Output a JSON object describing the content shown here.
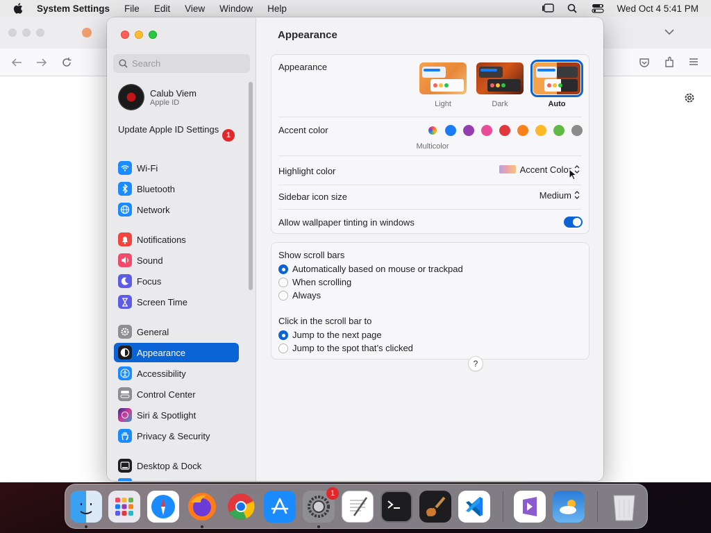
{
  "menubar": {
    "app_name": "System Settings",
    "items": [
      "File",
      "Edit",
      "View",
      "Window",
      "Help"
    ],
    "clock": "Wed Oct 4  5:41 PM"
  },
  "sidebar": {
    "search_placeholder": "Search",
    "profile": {
      "name": "Calub Viem",
      "subtitle": "Apple ID"
    },
    "update": {
      "label": "Update Apple ID Settings",
      "badge": "1"
    },
    "items": [
      {
        "label": "Wi-Fi",
        "icon": "wifi-icon",
        "color": "#1a8cff"
      },
      {
        "label": "Bluetooth",
        "icon": "bluetooth-icon",
        "color": "#1a8cff"
      },
      {
        "label": "Network",
        "icon": "globe-icon",
        "color": "#1a8cff"
      },
      {
        "label": "Notifications",
        "icon": "bell-icon",
        "color": "#f2453d"
      },
      {
        "label": "Sound",
        "icon": "speaker-icon",
        "color": "#f24a6a"
      },
      {
        "label": "Focus",
        "icon": "moon-icon",
        "color": "#5e5ce6"
      },
      {
        "label": "Screen Time",
        "icon": "hourglass-icon",
        "color": "#5e5ce6"
      },
      {
        "label": "General",
        "icon": "gear-icon",
        "color": "#8e8e93"
      },
      {
        "label": "Appearance",
        "icon": "appearance-icon",
        "color": "#1d1d1f"
      },
      {
        "label": "Accessibility",
        "icon": "accessibility-icon",
        "color": "#1a8cff"
      },
      {
        "label": "Control Center",
        "icon": "control-center-icon",
        "color": "#8e8e93"
      },
      {
        "label": "Siri & Spotlight",
        "icon": "siri-icon",
        "color": "#a040d0"
      },
      {
        "label": "Privacy & Security",
        "icon": "hand-icon",
        "color": "#1a8cff"
      },
      {
        "label": "Desktop & Dock",
        "icon": "dock-icon",
        "color": "#1d1d1f"
      }
    ]
  },
  "content": {
    "title": "Appearance",
    "appearance_row": {
      "label": "Appearance",
      "options": [
        "Light",
        "Dark",
        "Auto"
      ],
      "selected": "Auto"
    },
    "accent_row": {
      "label": "Accent color",
      "selected_caption": "Multicolor",
      "colors": [
        "multicolor",
        "#1a7cf5",
        "#953eb0",
        "#ea4c9a",
        "#e0383e",
        "#f7821b",
        "#fcb827",
        "#62ba46",
        "#8c8c8c"
      ]
    },
    "highlight_row": {
      "label": "Highlight color",
      "value": "Accent Color"
    },
    "sidebar_icon_row": {
      "label": "Sidebar icon size",
      "value": "Medium"
    },
    "tinting_row": {
      "label": "Allow wallpaper tinting in windows",
      "enabled": true
    },
    "scroll_bars": {
      "label": "Show scroll bars",
      "options": [
        "Automatically based on mouse or trackpad",
        "When scrolling",
        "Always"
      ],
      "selected": 0
    },
    "click_scroll": {
      "label": "Click in the scroll bar to",
      "options": [
        "Jump to the next page",
        "Jump to the spot that’s clicked"
      ],
      "selected": 0
    },
    "help_label": "?"
  },
  "dock": {
    "apps": [
      "finder-icon",
      "launchpad-icon",
      "safari-icon",
      "firefox-icon",
      "chrome-icon",
      "app-store-icon",
      "system-settings-icon",
      "textedit-icon",
      "terminal-icon",
      "garageband-icon",
      "vscode-icon",
      "visual-studio-icon",
      "weather-icon",
      "trash-icon"
    ],
    "settings_badge": "1"
  },
  "colors": {
    "accent": "#0a64d6",
    "badge": "#e0272a"
  }
}
